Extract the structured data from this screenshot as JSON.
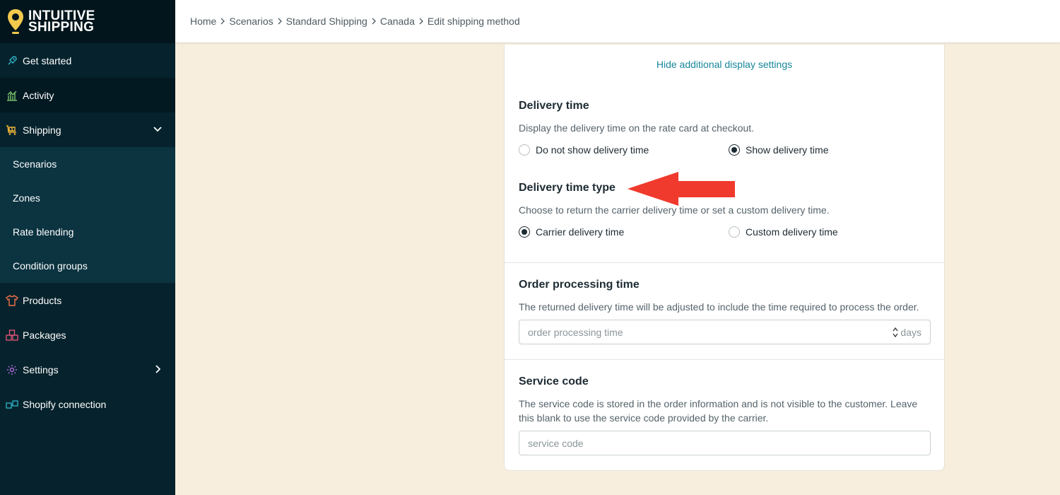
{
  "brand": {
    "line1": "INTUITIVE",
    "line2": "SHIPPING",
    "color": "#f2c94c"
  },
  "sidebar": {
    "items": [
      {
        "label": "Get started",
        "icon": "rocket-icon"
      },
      {
        "label": "Activity",
        "icon": "chart-icon"
      },
      {
        "label": "Shipping",
        "icon": "truck-icon",
        "expanded": true
      },
      {
        "label": "Products",
        "icon": "shirt-icon"
      },
      {
        "label": "Packages",
        "icon": "boxes-icon"
      },
      {
        "label": "Settings",
        "icon": "gear-icon"
      },
      {
        "label": "Shopify connection",
        "icon": "connection-icon"
      }
    ],
    "shipping_sub": [
      {
        "label": "Scenarios"
      },
      {
        "label": "Zones"
      },
      {
        "label": "Rate blending"
      },
      {
        "label": "Condition groups"
      }
    ]
  },
  "breadcrumb": [
    "Home",
    "Scenarios",
    "Standard Shipping",
    "Canada",
    "Edit shipping method"
  ],
  "card": {
    "hide_link": "Hide additional display settings",
    "delivery_time": {
      "title": "Delivery time",
      "desc": "Display the delivery time on the rate card at checkout.",
      "options": [
        {
          "label": "Do not show delivery time",
          "checked": false
        },
        {
          "label": "Show delivery time",
          "checked": true
        }
      ]
    },
    "delivery_time_type": {
      "title": "Delivery time type",
      "desc": "Choose to return the carrier delivery time or set a custom delivery time.",
      "options": [
        {
          "label": "Carrier delivery time",
          "checked": true
        },
        {
          "label": "Custom delivery time",
          "checked": false
        }
      ]
    },
    "order_processing": {
      "title": "Order processing time",
      "desc": "The returned delivery time will be adjusted to include the time required to process the order.",
      "placeholder": "order processing time",
      "value": "",
      "suffix": "days"
    },
    "service_code": {
      "title": "Service code",
      "desc": "The service code is stored in the order information and is not visible to the customer. Leave this blank to use the service code provided by the carrier.",
      "placeholder": "service code",
      "value": ""
    }
  },
  "colors": {
    "accent": "#17879a",
    "sidebar": "#06232d",
    "annotation_arrow": "#f03a2e"
  }
}
